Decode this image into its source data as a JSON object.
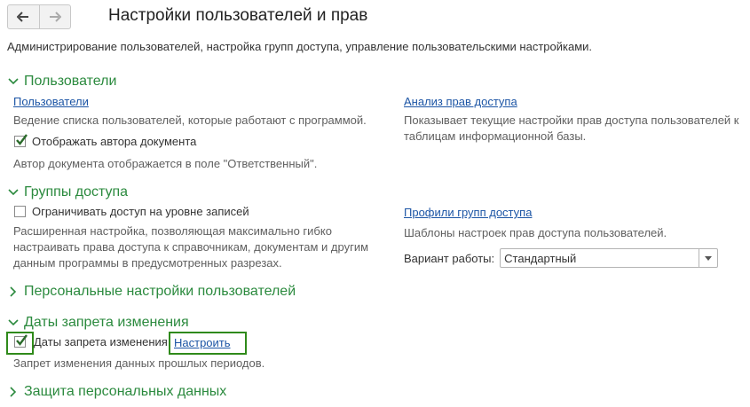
{
  "header": {
    "title": "Настройки пользователей и прав",
    "description": "Администрирование пользователей, настройка групп доступа, управление пользовательскими настройками."
  },
  "nav": {
    "back_icon": "arrow-left-icon",
    "forward_icon": "arrow-right-icon"
  },
  "colors": {
    "accent": "#2b8a3e",
    "link": "#1c55a5",
    "highlight_border": "#2f8a1a"
  },
  "sections": {
    "users": {
      "title": "Пользователи",
      "users_link": "Пользователи",
      "users_desc": "Ведение списка пользователей, которые работают с программой.",
      "show_author_label": "Отображать автора документа",
      "show_author_checked": true,
      "show_author_desc": "Автор документа отображается в поле \"Ответственный\".",
      "rights_link": "Анализ прав доступа",
      "rights_desc": "Показывает текущие настройки прав доступа пользователей к таблицам информационной базы."
    },
    "access_groups": {
      "title": "Группы доступа",
      "restrict_label": "Ограничивать доступ на уровне записей",
      "restrict_checked": false,
      "restrict_desc": "Расширенная настройка, позволяющая максимально гибко настраивать права доступа к справочникам, документам и другим данным программы в предусмотренных разрезах.",
      "profiles_link": "Профили групп доступа",
      "profiles_desc": "Шаблоны настроек прав доступа пользователей.",
      "mode_label": "Вариант работы:",
      "mode_value": "Стандартный"
    },
    "personal": {
      "title": "Персональные настройки пользователей"
    },
    "closing_dates": {
      "title": "Даты запрета изменения",
      "checkbox_label": "Даты запрета изменения",
      "checked": true,
      "setup_link": "Настроить",
      "desc": "Запрет изменения данных прошлых периодов."
    },
    "personal_data": {
      "title": "Защита персональных данных"
    }
  }
}
